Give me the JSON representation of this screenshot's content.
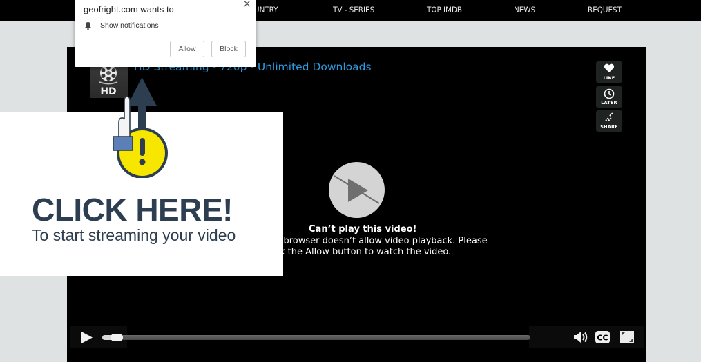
{
  "nav": {
    "items": [
      {
        "label": "UNTRY"
      },
      {
        "label": "TV - SERIES"
      },
      {
        "label": "TOP IMDB"
      },
      {
        "label": "NEWS"
      },
      {
        "label": "REQUEST"
      }
    ]
  },
  "player": {
    "logo_text": "HD",
    "title": "HD Streaming - 720p - Unlimited Downloads",
    "side_buttons": [
      {
        "label": "LIKE",
        "icon": "heart-icon"
      },
      {
        "label": "LATER",
        "icon": "clock-icon"
      },
      {
        "label": "SHARE",
        "icon": "share-icon"
      }
    ],
    "error_title": "Can’t play this video!",
    "error_line1": "r browser doesn’t allow video playback. Please",
    "error_line2": "k the Allow button to watch the video.",
    "progress_fraction": 0.03,
    "controls": {
      "play": "play-icon",
      "volume": "volume-icon",
      "cc": "CC",
      "fullscreen": "fullscreen-icon"
    }
  },
  "overlay_ad": {
    "headline": "CLICK HERE!",
    "subline": "To start streaming your video",
    "colors": {
      "text": "#2d3e50",
      "badge": "#f7e600",
      "cuff": "#5b7fb6"
    }
  },
  "notification_prompt": {
    "title": "geofright.com wants to",
    "permission": "Show notifications",
    "allow_label": "Allow",
    "block_label": "Block",
    "close_glyph": "×"
  }
}
